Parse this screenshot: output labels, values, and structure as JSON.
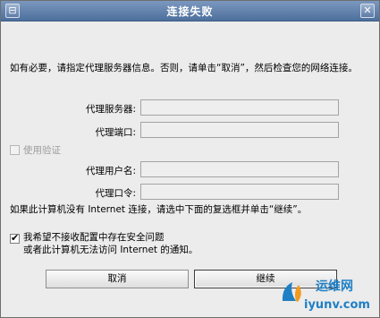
{
  "window": {
    "title": "连接失败",
    "close_glyph": "✕",
    "sysmenu_glyph": "⊟"
  },
  "intro": "如有必要，请指定代理服务器信息。否则，请单击“取消”，然后检查您的网络连接。",
  "proxy": {
    "server_label": "代理服务器:",
    "server_value": "",
    "port_label": "代理端口:",
    "port_value": "",
    "use_auth_label": "使用验证",
    "use_auth_checked": false,
    "username_label": "代理用户名:",
    "username_value": "",
    "password_label": "代理口令:",
    "password_value": ""
  },
  "no_internet_text": "如果此计算机没有 Internet 连接，请选中下面的复选框并单击“继续”。",
  "opt_out": {
    "line1": "我希望不接收配置中存在安全问题",
    "line2": "或者此计算机无法访问 Internet 的通知。",
    "checked": true,
    "check_glyph": "✔"
  },
  "buttons": {
    "cancel": "取消",
    "continue": "继续"
  },
  "watermark": {
    "cn": "运维网",
    "domain": "iyunv.com",
    "colors": {
      "blue": "#1f7fc4",
      "orange": "#f29a1f"
    }
  }
}
